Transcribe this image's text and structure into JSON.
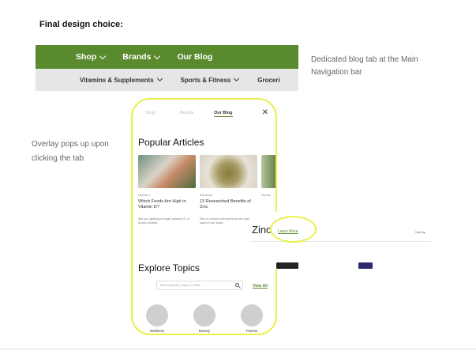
{
  "heading": "Final design choice:",
  "nav": {
    "primary": [
      "Shop",
      "Brands",
      "Our Blog"
    ],
    "secondary": [
      "Vitamins & Supplements",
      "Sports & Fitness",
      "Groceri"
    ]
  },
  "notes": {
    "right": "Dedicated blog tab at the Main Navigation bar",
    "left": "Overlay pops up upon clicking the tab"
  },
  "phone": {
    "tabs": [
      "Shop",
      "Brands",
      "Our Blog"
    ],
    "close": "✕",
    "popular_heading": "Popular Articles",
    "articles": [
      {
        "category": "Nutrition",
        "title": "Which Foods Are High in Vitamin D?",
        "excerpt": "Are you getting enough vitamin D? A doctor shares..."
      },
      {
        "category": "Wellness",
        "title": "13 Researched Benefits of Zinc",
        "excerpt": "Zinc is a trace mineral that has many uses in our body..."
      },
      {
        "category": "Goodn",
        "title": "",
        "excerpt": ""
      }
    ],
    "explore_heading": "Explore Topics",
    "search_placeholder": "Enter Keywords, Topics, or Titles",
    "view_all": "View All",
    "topics": [
      "Wellness",
      "Beauty",
      "Fitness"
    ]
  },
  "strip": {
    "title": "Zinc",
    "learn_more": "Learn More",
    "sort": "Sort by"
  },
  "colors": {
    "brand_green": "#5a8a2e",
    "highlight_yellow": "#eaf04a",
    "nav_grey": "#e6e6e6"
  }
}
